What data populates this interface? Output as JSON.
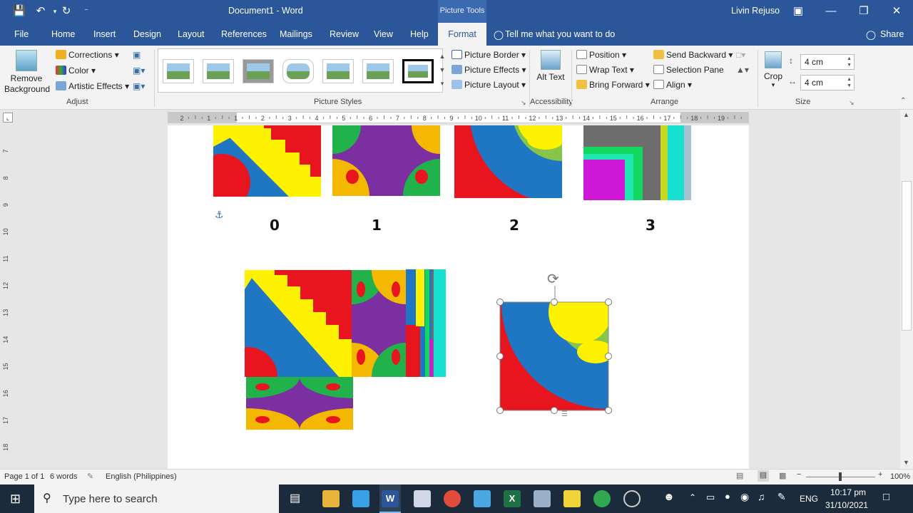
{
  "titlebar": {
    "title": "Document1 - Word",
    "context_tab": "Picture Tools",
    "user": "Livin Rejuso"
  },
  "tabs": [
    "File",
    "Home",
    "Insert",
    "Design",
    "Layout",
    "References",
    "Mailings",
    "Review",
    "View",
    "Help",
    "Format"
  ],
  "tell_me": "Tell me what you want to do",
  "share": "Share",
  "ribbon": {
    "adjust": {
      "remove_bg": "Remove Background",
      "corrections": "Corrections",
      "color": "Color",
      "artistic": "Artistic Effects",
      "label": "Adjust"
    },
    "styles": {
      "label": "Picture Styles",
      "border": "Picture Border",
      "effects": "Picture Effects",
      "layout": "Picture Layout"
    },
    "accessibility": {
      "alt_text": "Alt Text",
      "label": "Accessibility"
    },
    "arrange": {
      "position": "Position",
      "wrap": "Wrap Text",
      "bring_forward": "Bring Forward",
      "send_backward": "Send Backward",
      "selection_pane": "Selection Pane",
      "align": "Align",
      "label": "Arrange"
    },
    "size": {
      "crop": "Crop",
      "height": "4 cm",
      "width": "4 cm",
      "label": "Size"
    }
  },
  "ruler_numbers": [
    "2",
    "1",
    "1",
    "2",
    "3",
    "4",
    "5",
    "6",
    "7",
    "8",
    "9",
    "10",
    "11",
    "12",
    "13",
    "14",
    "15",
    "16",
    "17",
    "18",
    "19"
  ],
  "vruler_numbers": [
    "7",
    "8",
    "9",
    "10",
    "11",
    "12",
    "13",
    "14",
    "15",
    "16",
    "17",
    "18"
  ],
  "doc": {
    "labels": [
      "0",
      "1",
      "2",
      "3"
    ]
  },
  "status": {
    "page": "Page 1 of 1",
    "words": "6 words",
    "language": "English (Philippines)",
    "zoom": "100%"
  },
  "taskbar": {
    "search_placeholder": "Type here to search",
    "language": "ENG",
    "time": "10:17 pm",
    "date": "31/10/2021"
  },
  "colors": {
    "word_blue": "#2b579a",
    "tile_red": "#e8141e",
    "tile_yellow": "#fff200",
    "tile_blue": "#1f77c4",
    "tile_green": "#22b24c",
    "tile_purple": "#7b2fa0",
    "tile_orange": "#f5b800"
  }
}
